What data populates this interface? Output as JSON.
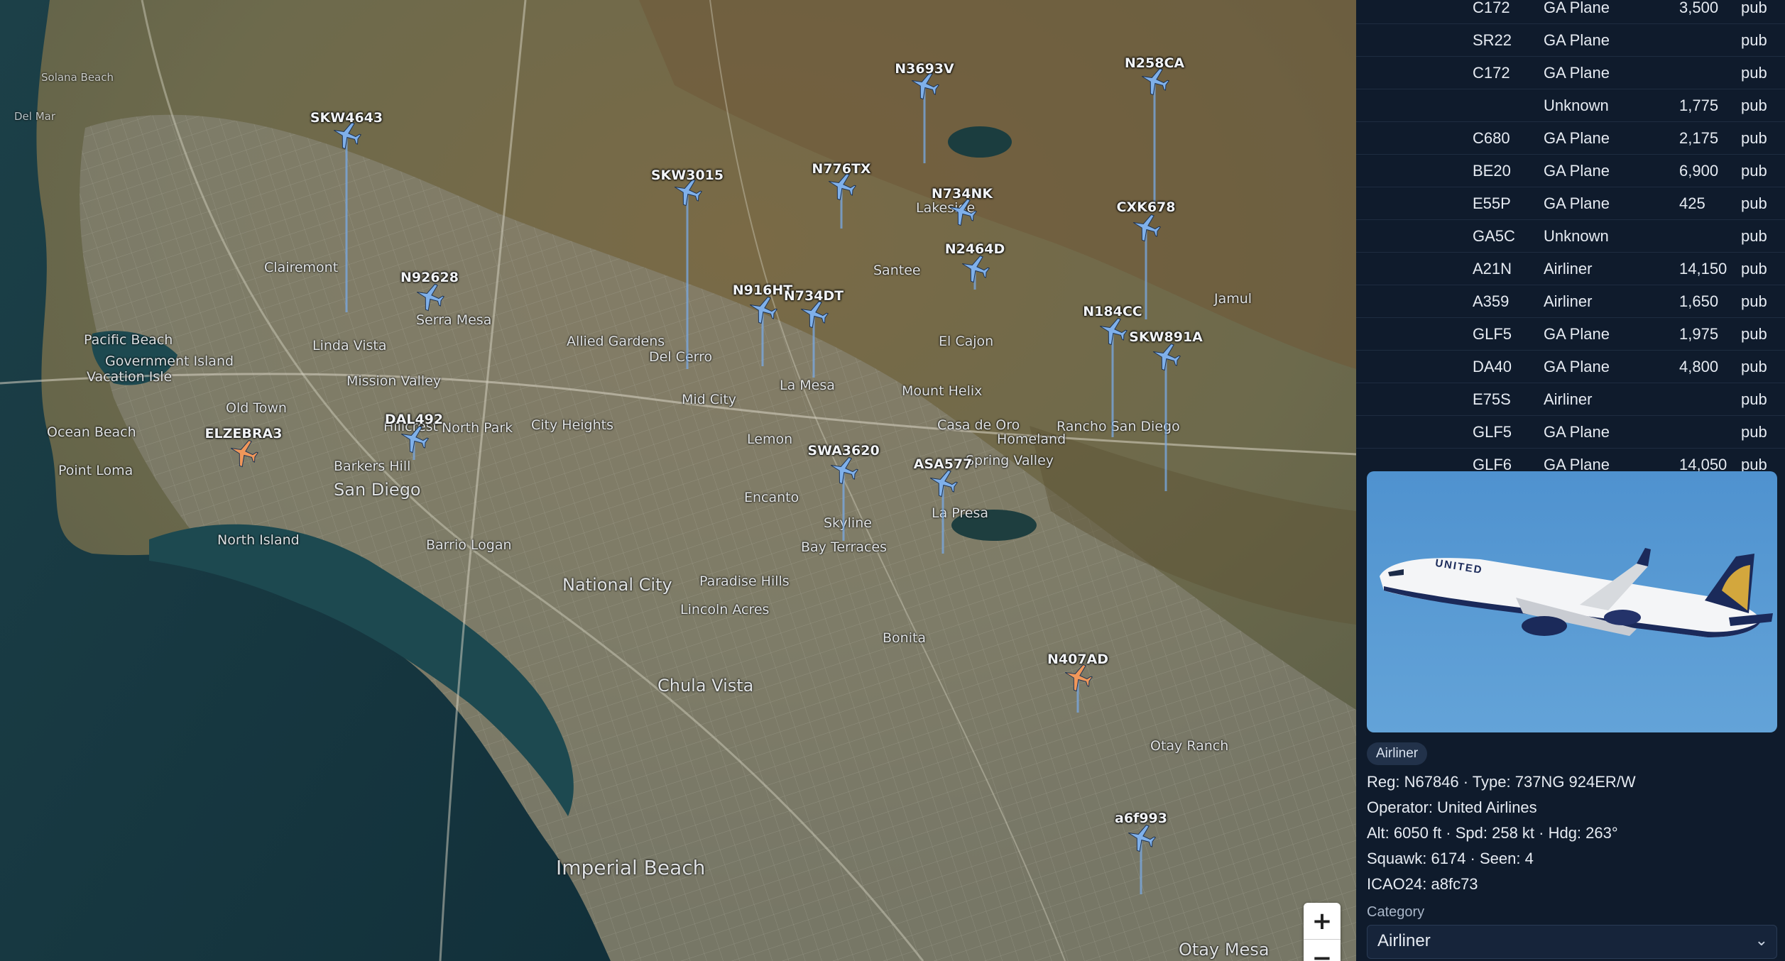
{
  "map": {
    "places": [
      {
        "name": "Del Mar",
        "size": "sm"
      },
      {
        "name": "Solana Beach",
        "size": "sm"
      },
      {
        "name": "Pacific Beach",
        "size": "md"
      },
      {
        "name": "Government Island",
        "size": "md"
      },
      {
        "name": "Vacation Isle",
        "size": "md"
      },
      {
        "name": "Ocean Beach",
        "size": "md"
      },
      {
        "name": "Point Loma",
        "size": "md"
      },
      {
        "name": "Old Town",
        "size": "md"
      },
      {
        "name": "Hillcrest",
        "size": "md"
      },
      {
        "name": "North Park",
        "size": "md"
      },
      {
        "name": "City Heights",
        "size": "md"
      },
      {
        "name": "Barkers Hill",
        "size": "md"
      },
      {
        "name": "San Diego",
        "size": "lg"
      },
      {
        "name": "North Island",
        "size": "md"
      },
      {
        "name": "Barrio Logan",
        "size": "md"
      },
      {
        "name": "National City",
        "size": "lg"
      },
      {
        "name": "Paradise Hills",
        "size": "md"
      },
      {
        "name": "Lincoln Acres",
        "size": "md"
      },
      {
        "name": "Chula Vista",
        "size": "lg"
      },
      {
        "name": "Bonita",
        "size": "md"
      },
      {
        "name": "Otay Ranch",
        "size": "md"
      },
      {
        "name": "Imperial Beach",
        "size": "xl"
      },
      {
        "name": "Otay Mesa",
        "size": "lg"
      },
      {
        "name": "Lemon",
        "size": "md"
      },
      {
        "name": "Encanto",
        "size": "md"
      },
      {
        "name": "Skyline",
        "size": "md"
      },
      {
        "name": "Bay Terraces",
        "size": "md"
      },
      {
        "name": "La Presa",
        "size": "md"
      },
      {
        "name": "Spring Valley",
        "size": "md"
      },
      {
        "name": "Casa de Oro",
        "size": "md"
      },
      {
        "name": "Homeland",
        "size": "md"
      },
      {
        "name": "Rancho San Diego",
        "size": "md"
      },
      {
        "name": "Mount Helix",
        "size": "md"
      },
      {
        "name": "La Mesa",
        "size": "md"
      },
      {
        "name": "El Cajon",
        "size": "md"
      },
      {
        "name": "Allied Gardens",
        "size": "md"
      },
      {
        "name": "Del Cerro",
        "size": "md"
      },
      {
        "name": "Linda Vista",
        "size": "md"
      },
      {
        "name": "Mission Valley",
        "size": "md"
      },
      {
        "name": "Clairemont",
        "size": "md"
      },
      {
        "name": "Serra Mesa",
        "size": "md"
      },
      {
        "name": "Santee",
        "size": "md"
      },
      {
        "name": "Lakeside",
        "size": "md"
      },
      {
        "name": "Jamul",
        "size": "md"
      },
      {
        "name": "Mid City",
        "size": "md"
      }
    ],
    "aircraft": [
      {
        "callsign": "SKW4643"
      },
      {
        "callsign": "N92628"
      },
      {
        "callsign": "SKW3015"
      },
      {
        "callsign": "N776TX"
      },
      {
        "callsign": "N3693V"
      },
      {
        "callsign": "N258CA"
      },
      {
        "callsign": "N734NK"
      },
      {
        "callsign": "N2464D"
      },
      {
        "callsign": "CXK678"
      },
      {
        "callsign": "N916HT"
      },
      {
        "callsign": "N734DT"
      },
      {
        "callsign": "N184CC"
      },
      {
        "callsign": "SKW891A"
      },
      {
        "callsign": "DAL492"
      },
      {
        "callsign": "ELZEBRA3"
      },
      {
        "callsign": "SWA3620"
      },
      {
        "callsign": "ASA577"
      },
      {
        "callsign": "N407AD"
      },
      {
        "callsign": "a6f993"
      }
    ],
    "zoom_in": "+",
    "zoom_out": "−"
  },
  "flights": [
    {
      "type": "C172",
      "category": "GA Plane",
      "alt": "3,500",
      "src": "pub"
    },
    {
      "type": "SR22",
      "category": "GA Plane",
      "alt": "",
      "src": "pub"
    },
    {
      "type": "C172",
      "category": "GA Plane",
      "alt": "",
      "src": "pub"
    },
    {
      "type": "",
      "category": "Unknown",
      "alt": "1,775",
      "src": "pub"
    },
    {
      "type": "C680",
      "category": "GA Plane",
      "alt": "2,175",
      "src": "pub"
    },
    {
      "type": "BE20",
      "category": "GA Plane",
      "alt": "6,900",
      "src": "pub"
    },
    {
      "type": "E55P",
      "category": "GA Plane",
      "alt": "425",
      "src": "pub"
    },
    {
      "type": "GA5C",
      "category": "Unknown",
      "alt": "",
      "src": "pub"
    },
    {
      "type": "A21N",
      "category": "Airliner",
      "alt": "14,150",
      "src": "pub"
    },
    {
      "type": "A359",
      "category": "Airliner",
      "alt": "1,650",
      "src": "pub"
    },
    {
      "type": "GLF5",
      "category": "GA Plane",
      "alt": "1,975",
      "src": "pub"
    },
    {
      "type": "DA40",
      "category": "GA Plane",
      "alt": "4,800",
      "src": "pub"
    },
    {
      "type": "E75S",
      "category": "Airliner",
      "alt": "",
      "src": "pub"
    },
    {
      "type": "GLF5",
      "category": "GA Plane",
      "alt": "",
      "src": "pub"
    },
    {
      "type": "GLF6",
      "category": "GA Plane",
      "alt": "14,050",
      "src": "pub"
    }
  ],
  "selected": {
    "photo_livery_text": "UNITED",
    "badge": "Airliner",
    "reg_line": "Reg: N67846 · Type: 737NG 924ER/W",
    "operator_line": "Operator: United Airlines",
    "alt_line": "Alt: 6050 ft · Spd: 258 kt · Hdg: 263°",
    "squawk_line": "Squawk: 6174 · Seen: 4",
    "icao_line": "ICAO24: a8fc73",
    "category_label": "Category",
    "category_value": "Airliner"
  },
  "colors": {
    "aircraft_blue": "#7fb0ea",
    "aircraft_orange": "#f0975a",
    "sidebar_bg": "#0f1b2c",
    "ocean": "#163a40"
  }
}
